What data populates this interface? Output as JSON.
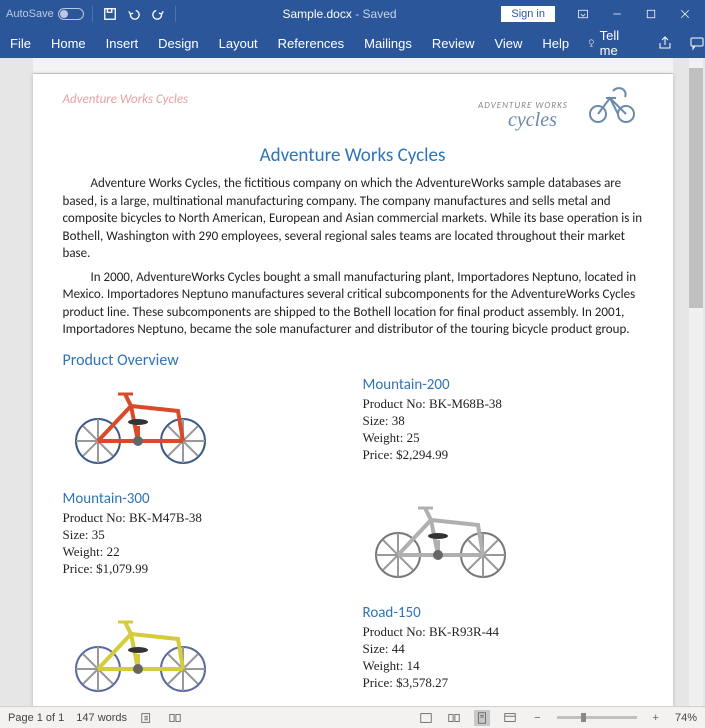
{
  "titlebar": {
    "autosave": "AutoSave",
    "filename": "Sample.docx",
    "saved": "Saved",
    "signin": "Sign in"
  },
  "ribbon": {
    "tabs": [
      "File",
      "Home",
      "Insert",
      "Design",
      "Layout",
      "References",
      "Mailings",
      "Review",
      "View",
      "Help"
    ],
    "tellme": "Tell me"
  },
  "doc": {
    "header_text": "Adventure Works Cycles",
    "logo_text1": "ADVENTURE WORKS",
    "logo_text2": "cycles",
    "title": "Adventure Works Cycles",
    "para1": "Adventure Works Cycles, the fictitious company on which the AdventureWorks sample databases are based, is a large, multinational manufacturing company. The company manufactures and sells metal and composite bicycles to North American, European and Asian commercial markets. While its base operation is in Bothell, Washington with 290 employees, several regional sales teams are located throughout their market base.",
    "para2": "In 2000, AdventureWorks Cycles bought a small manufacturing plant, Importadores Neptuno, located in Mexico. Importadores Neptuno manufactures several critical subcomponents for the AdventureWorks Cycles product line. These subcomponents are shipped to the Bothell location for final product assembly. In 2001, Importadores Neptuno, became the sole manufacturer and distributor of the touring bicycle product group.",
    "section": "Product Overview",
    "labels": {
      "productno": "Product No:",
      "size": "Size:",
      "weight": "Weight:",
      "price": "Price:"
    },
    "products": [
      {
        "name": "Mountain-200",
        "no": "BK-M68B-38",
        "size": "38",
        "weight": "25",
        "price": "$2,294.99",
        "frame": "#d94a2a",
        "wheel": "#3b5a8a"
      },
      {
        "name": "Mountain-300",
        "no": "BK-M47B-38",
        "size": "35",
        "weight": "22",
        "price": "$1,079.99",
        "frame": "#b0b0b0",
        "wheel": "#777"
      },
      {
        "name": "Road-150",
        "no": "BK-R93R-44",
        "size": "44",
        "weight": "14",
        "price": "$3,578.27",
        "frame": "#d4cc3a",
        "wheel": "#5a6aa0"
      }
    ]
  },
  "statusbar": {
    "page": "Page 1 of 1",
    "words": "147 words",
    "zoom": "74%"
  }
}
